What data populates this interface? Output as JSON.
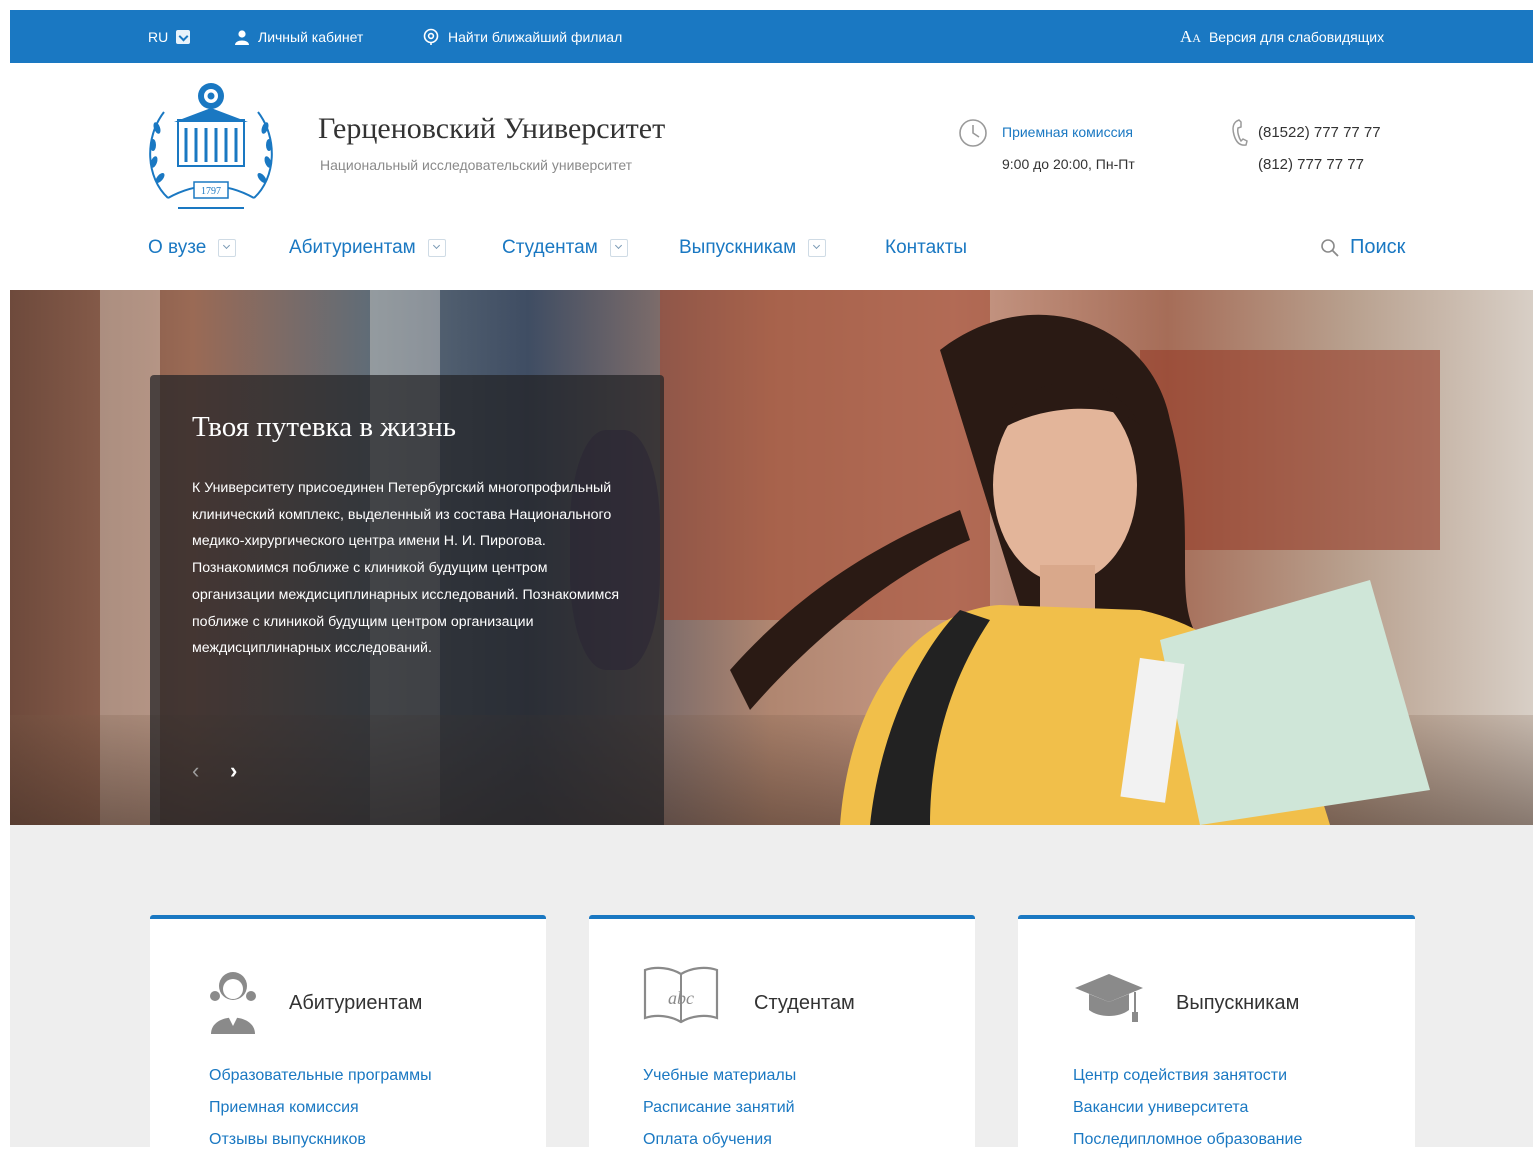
{
  "topbar": {
    "lang": "RU",
    "account": "Личный кабинет",
    "branch": "Найти ближайший филиал",
    "accessibility_icon": "Aa",
    "accessibility": "Версия для слабовидящих"
  },
  "header": {
    "title": "Герценовский Университет",
    "subtitle": "Национальный исследовательский университет",
    "logo_year": "1797",
    "admission_link": "Приемная комиссия",
    "admission_hours": "9:00 до 20:00, Пн-Пт",
    "phone1": "(81522) 777 77 77",
    "phone2": "(812) 777 77 77"
  },
  "nav": {
    "items": [
      "О вузе",
      "Абитуриентам",
      "Студентам",
      "Выпускникам",
      "Контакты"
    ],
    "search": "Поиск"
  },
  "hero": {
    "title": "Твоя путевка в жизнь",
    "text": "К Университету присоединен Петербургский многопрофильный клинический комплекс, выделенный из состава Национального медико-хирургического центра имени Н. И. Пирогова. Познакомимся поближе с клиникой будущим центром организации междисциплинарных исследований. Познакомимся поближе с клиникой будущим центром организации междисциплинарных исследований.",
    "prev": "‹",
    "next": "›"
  },
  "cards": [
    {
      "title": "Абитуриентам",
      "icon": "applicant-icon",
      "links": [
        "Образовательные программы",
        "Приемная комиссия",
        "Отзывы выпускников"
      ]
    },
    {
      "title": "Студентам",
      "icon": "book-icon",
      "links": [
        "Учебные материалы",
        "Расписание занятий",
        "Оплата обучения"
      ]
    },
    {
      "title": "Выпускникам",
      "icon": "graduation-cap-icon",
      "links": [
        "Центр содействия занятости",
        "Вакансии университета",
        "Последипломное образование"
      ]
    }
  ],
  "colors": {
    "brand_blue": "#1a78c2",
    "lower_bg": "#eeeeee"
  }
}
